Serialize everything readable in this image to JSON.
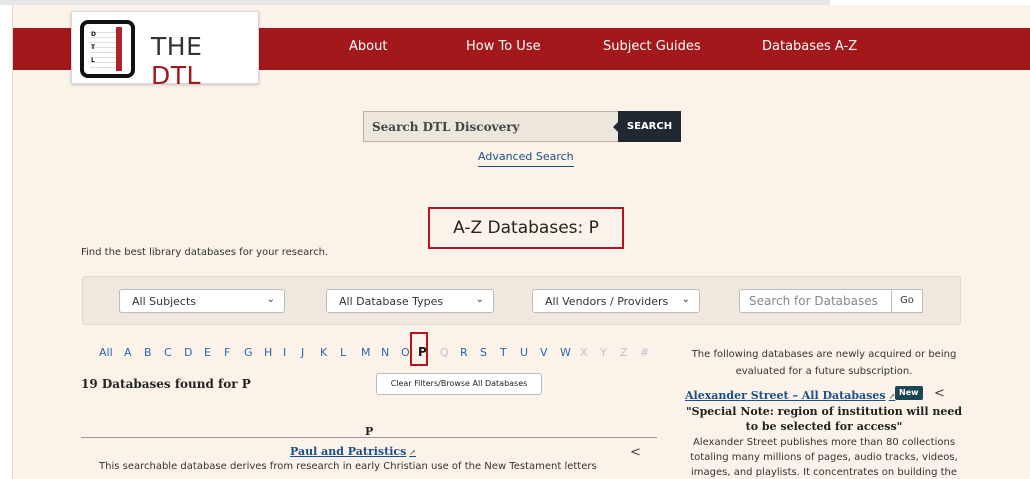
{
  "logo": {
    "text_the": "THE",
    "text_dtl": "DTL",
    "book_letters": [
      "D",
      "T",
      "L"
    ]
  },
  "nav": {
    "items": [
      "About",
      "How To Use",
      "Subject Guides",
      "Databases A-Z"
    ]
  },
  "search": {
    "placeholder": "Search DTL Discovery",
    "button": "SEARCH",
    "advanced": "Advanced Search"
  },
  "main": {
    "heading": "A-Z Databases: P",
    "tagline": "Find the best library databases for your research.",
    "filters": {
      "subjects": "All Subjects",
      "types": "All Database Types",
      "vendors": "All Vendors / Providers",
      "search_placeholder": "Search for Databases",
      "go": "Go"
    },
    "az": {
      "letters": [
        "All",
        "A",
        "B",
        "C",
        "D",
        "E",
        "F",
        "G",
        "H",
        "I",
        "J",
        "K",
        "L",
        "M",
        "N",
        "O",
        "P",
        "Q",
        "R",
        "S",
        "T",
        "U",
        "V",
        "W",
        "X",
        "Y",
        "Z",
        "#"
      ],
      "current": "P",
      "disabled": [
        "Q",
        "X",
        "Y",
        "Z",
        "#"
      ]
    },
    "found": "19 Databases found for P",
    "clear": "Clear Filters/Browse All Databases",
    "group": "P",
    "databases": [
      {
        "title": "Paul and Patristics",
        "desc": "This searchable database derives from research in early Christian use of the New Testament letters"
      }
    ]
  },
  "sidebar": {
    "intro": "The following databases are newly acquired or being evaluated for a future subscription.",
    "new_db": {
      "title": "Alexander Street – All Databases",
      "badge": "New",
      "note": "\"Special Note: region of institution will need to be selected for access\"",
      "desc": "Alexander Street publishes more than 80 collections totaling many millions of pages, audio tracks, videos, images, and playlists. It concentrates on building the"
    }
  },
  "icons": {
    "external": "external-link-icon",
    "share": "share-icon",
    "chevron": "chevron-down-icon"
  },
  "colors": {
    "brand_red": "#a3191b",
    "page_bg": "#fbf3ea",
    "link_blue": "#1a4f8a",
    "dark_button": "#222831"
  }
}
